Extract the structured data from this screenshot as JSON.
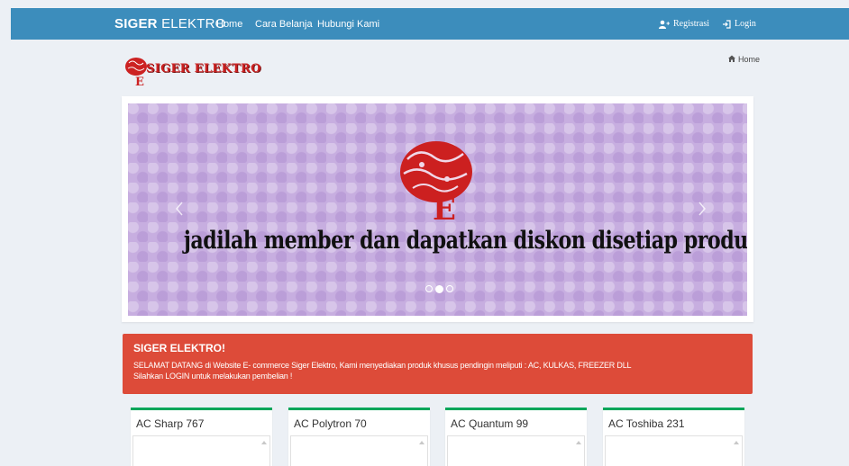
{
  "navbar": {
    "brand_bold": "SIGER",
    "brand_rest": "ELEKTRO",
    "links": [
      "Home",
      "Cara Belanja",
      "Hubungi Kami"
    ],
    "registrasi": "Registrasi",
    "login": "Login"
  },
  "header": {
    "logo_text": "SIGER ELEKTRO",
    "breadcrumb": "Home"
  },
  "carousel": {
    "slide_text": "jadilah member dan dapatkan diskon disetiap produk",
    "active_index": 1,
    "slide_count": 3
  },
  "callout": {
    "title": "SIGER ELEKTRO!",
    "line1": "SELAMAT DATANG di Website E- commerce Siger Elektro, Kami menyediakan produk khusus pendingin meliputi : AC, KULKAS, FREEZER DLL",
    "line2": "Silahkan LOGIN untuk melakukan pembelian !"
  },
  "products": [
    {
      "name": "AC Sharp 767"
    },
    {
      "name": "AC Polytron 70"
    },
    {
      "name": "AC Quantum 99"
    },
    {
      "name": "AC Toshiba 231"
    }
  ],
  "colors": {
    "navbar": "#3c8dbc",
    "callout": "#dd4b39",
    "product_border": "#00a65a",
    "slide_bg": "#c7aee0",
    "logo_red": "#cc2222"
  },
  "icons": {
    "registrasi": "user-plus-icon",
    "login": "sign-in-icon",
    "breadcrumb": "home-icon",
    "prev": "chevron-left-icon",
    "next": "chevron-right-icon"
  }
}
